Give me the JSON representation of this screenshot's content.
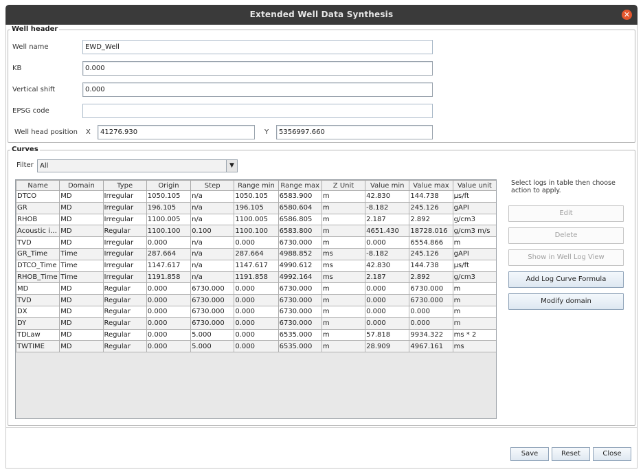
{
  "window": {
    "title": "Extended Well Data Synthesis",
    "close_glyph": "✕"
  },
  "well_header": {
    "legend": "Well header",
    "well_name_label": "Well name",
    "well_name_value": "EWD_Well",
    "kb_label": "KB",
    "kb_value": "0.000",
    "vshift_label": "Vertical shift",
    "vshift_value": "0.000",
    "epsg_label": "EPSG code",
    "epsg_value": "",
    "head_label": "Well head position",
    "x_label": "X",
    "x_value": "41276.930",
    "y_label": "Y",
    "y_value": "5356997.660"
  },
  "curves": {
    "legend": "Curves",
    "filter_label": "Filter",
    "filter_value": "All",
    "columns": [
      "Name",
      "Domain",
      "Type",
      "Origin",
      "Step",
      "Range min",
      "Range max",
      "Z Unit",
      "Value min",
      "Value max",
      "Value unit"
    ],
    "rows": [
      [
        "DTCO",
        "MD",
        "Irregular",
        "1050.105",
        "n/a",
        "1050.105",
        "6583.900",
        "m",
        "42.830",
        "144.738",
        "µs/ft"
      ],
      [
        "GR",
        "MD",
        "Irregular",
        "196.105",
        "n/a",
        "196.105",
        "6580.604",
        "m",
        "-8.182",
        "245.126",
        "gAPI"
      ],
      [
        "RHOB",
        "MD",
        "Irregular",
        "1100.005",
        "n/a",
        "1100.005",
        "6586.805",
        "m",
        "2.187",
        "2.892",
        "g/cm3"
      ],
      [
        "Acoustic im...",
        "MD",
        "Regular",
        "1100.100",
        "0.100",
        "1100.100",
        "6583.800",
        "m",
        "4651.430",
        "18728.016",
        "g/cm3 m/s"
      ],
      [
        "TVD",
        "MD",
        "Irregular",
        "0.000",
        "n/a",
        "0.000",
        "6730.000",
        "m",
        "0.000",
        "6554.866",
        "m"
      ],
      [
        "GR_Time",
        "Time",
        "Irregular",
        "287.664",
        "n/a",
        "287.664",
        "4988.852",
        "ms",
        "-8.182",
        "245.126",
        "gAPI"
      ],
      [
        "DTCO_Time",
        "Time",
        "Irregular",
        "1147.617",
        "n/a",
        "1147.617",
        "4990.612",
        "ms",
        "42.830",
        "144.738",
        "µs/ft"
      ],
      [
        "RHOB_Time",
        "Time",
        "Irregular",
        "1191.858",
        "n/a",
        "1191.858",
        "4992.164",
        "ms",
        "2.187",
        "2.892",
        "g/cm3"
      ],
      [
        "MD",
        "MD",
        "Regular",
        "0.000",
        "6730.000",
        "0.000",
        "6730.000",
        "m",
        "0.000",
        "6730.000",
        "m"
      ],
      [
        "TVD",
        "MD",
        "Regular",
        "0.000",
        "6730.000",
        "0.000",
        "6730.000",
        "m",
        "0.000",
        "6730.000",
        "m"
      ],
      [
        "DX",
        "MD",
        "Regular",
        "0.000",
        "6730.000",
        "0.000",
        "6730.000",
        "m",
        "0.000",
        "0.000",
        "m"
      ],
      [
        "DY",
        "MD",
        "Regular",
        "0.000",
        "6730.000",
        "0.000",
        "6730.000",
        "m",
        "0.000",
        "0.000",
        "m"
      ],
      [
        "TDLaw",
        "MD",
        "Regular",
        "0.000",
        "5.000",
        "0.000",
        "6535.000",
        "m",
        "57.818",
        "9934.322",
        "ms * 2"
      ],
      [
        "TWTIME",
        "MD",
        "Regular",
        "0.000",
        "5.000",
        "0.000",
        "6535.000",
        "m",
        "28.909",
        "4967.161",
        "ms"
      ]
    ],
    "hint": "Select logs in table then choose action to apply.",
    "buttons": {
      "edit": "Edit",
      "delete": "Delete",
      "show": "Show in Well Log View",
      "add_formula": "Add Log Curve Formula",
      "modify_domain": "Modify domain"
    }
  },
  "footer": {
    "save": "Save",
    "reset": "Reset",
    "close": "Close"
  },
  "icons": {
    "filter_dropdown": "chevron-down-icon",
    "window_close": "close-icon"
  },
  "colors": {
    "titlebar": "#3a3a3a",
    "close_button": "#e4572e"
  }
}
